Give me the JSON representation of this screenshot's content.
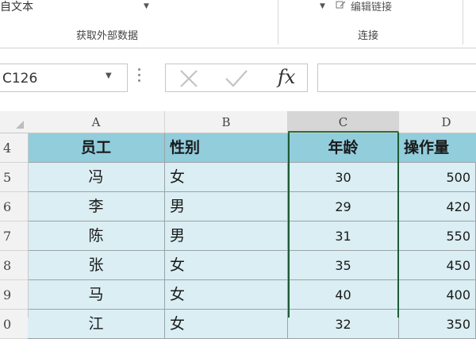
{
  "ribbon": {
    "top_left_text": "自文本",
    "top_right_text": "编辑链接",
    "group_get_external": "获取外部数据",
    "group_connections": "连接"
  },
  "formula_bar": {
    "name_box": "C126",
    "fx_label": "fx",
    "formula_value": ""
  },
  "columns": [
    "A",
    "B",
    "C",
    "D"
  ],
  "selected_column": "C",
  "rows": [
    {
      "num": "4",
      "a": "员工",
      "b": "性别",
      "c": "年龄",
      "d": "操作量"
    },
    {
      "num": "5",
      "a": "冯",
      "b": "女",
      "c": "30",
      "d": "500"
    },
    {
      "num": "6",
      "a": "李",
      "b": "男",
      "c": "29",
      "d": "420"
    },
    {
      "num": "7",
      "a": "陈",
      "b": "男",
      "c": "31",
      "d": "550"
    },
    {
      "num": "8",
      "a": "张",
      "b": "女",
      "c": "35",
      "d": "450"
    },
    {
      "num": "9",
      "a": "马",
      "b": "女",
      "c": "40",
      "d": "400"
    },
    {
      "num": "0",
      "a": "江",
      "b": "女",
      "c": "32",
      "d": "350"
    }
  ],
  "colors": {
    "header_fill": "#92cddc",
    "data_fill": "#daeef3",
    "selection_border": "#1e5b35"
  },
  "icons": [
    "dropdown-arrow-icon",
    "link-icon",
    "cancel-x-icon",
    "enter-check-icon",
    "insert-function-icon",
    "select-all-icon"
  ]
}
